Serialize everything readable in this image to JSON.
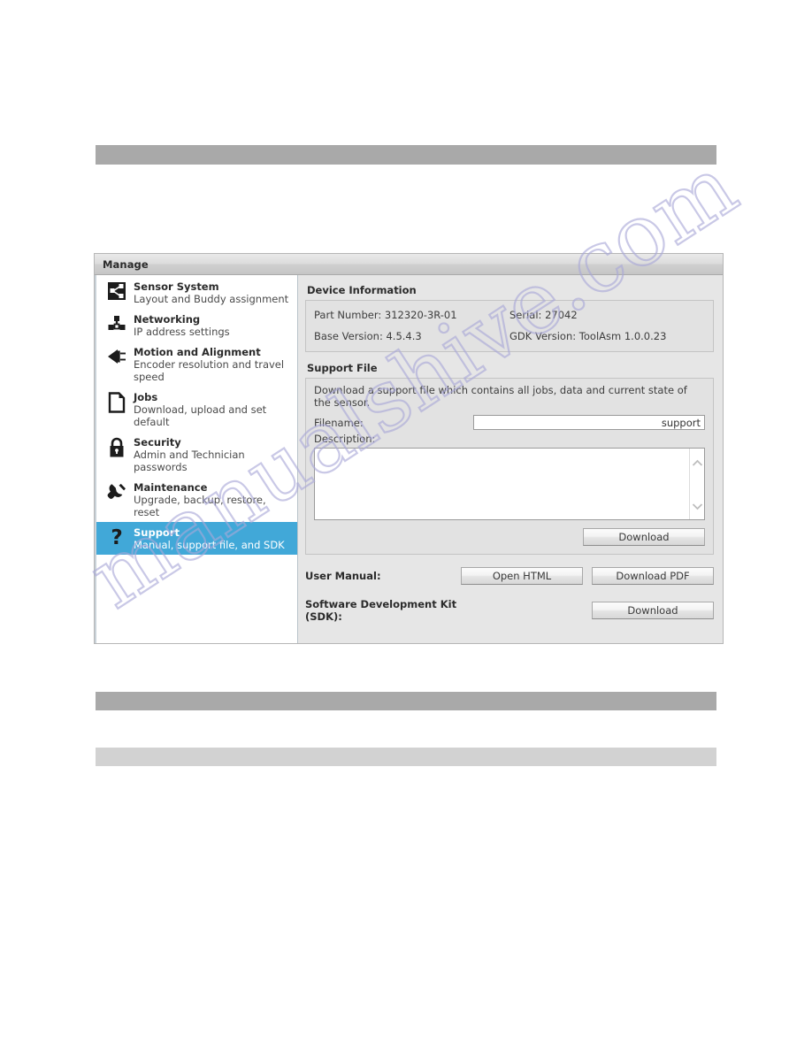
{
  "window": {
    "title": "Manage"
  },
  "sidebar": {
    "items": [
      {
        "icon": "share-nodes-icon",
        "title": "Sensor System",
        "subtitle": "Layout and Buddy assignment",
        "selected": false
      },
      {
        "icon": "network-tee-icon",
        "title": "Networking",
        "subtitle": "IP address settings",
        "selected": false
      },
      {
        "icon": "motion-arrow-icon",
        "title": "Motion and Alignment",
        "subtitle": "Encoder resolution and travel speed",
        "selected": false
      },
      {
        "icon": "document-page-icon",
        "title": "Jobs",
        "subtitle": "Download, upload and set default",
        "selected": false
      },
      {
        "icon": "padlock-icon",
        "title": "Security",
        "subtitle": "Admin and Technician passwords",
        "selected": false
      },
      {
        "icon": "wrench-icon",
        "title": "Maintenance",
        "subtitle": "Upgrade, backup, restore, reset",
        "selected": false
      },
      {
        "icon": "question-mark-icon",
        "title": "Support",
        "subtitle": "Manual, support file, and SDK",
        "selected": true
      }
    ]
  },
  "device_information": {
    "heading": "Device Information",
    "fields": [
      {
        "label": "Part Number:",
        "value": "312320-3R-01"
      },
      {
        "label": "Serial:",
        "value": "27042"
      },
      {
        "label": "Base Version:",
        "value": "4.5.4.3"
      },
      {
        "label": "GDK Version:",
        "value": "ToolAsm 1.0.0.23"
      }
    ]
  },
  "support_file": {
    "heading": "Support File",
    "description_line": "Download a support file which contains all jobs, data and current state of the sensor.",
    "filename_label": "Filename:",
    "filename_value": "support",
    "filename_placeholder": "",
    "description_label": "Description:",
    "description_value": "",
    "download_button": "Download",
    "scroll_up_icon": "chevron-up-icon",
    "scroll_down_icon": "chevron-down-icon"
  },
  "bottom_actions": [
    {
      "label": "User Manual:",
      "buttons": [
        {
          "name": "open-html-button",
          "text": "Open HTML"
        },
        {
          "name": "download-pdf-button",
          "text": "Download PDF"
        }
      ]
    },
    {
      "label": "Software Development Kit (SDK):",
      "buttons": [
        {
          "name": "download-sdk-button",
          "text": "Download"
        }
      ]
    }
  ],
  "watermark": {
    "line1": "manualshive.com"
  },
  "colors": {
    "selection_blue": "#41a8d8",
    "panel_gray": "#e6e6e6",
    "redaction_dark": "#a9a9a9",
    "redaction_light": "#d2d2d2",
    "watermark_purple": "#a9a8d8"
  }
}
